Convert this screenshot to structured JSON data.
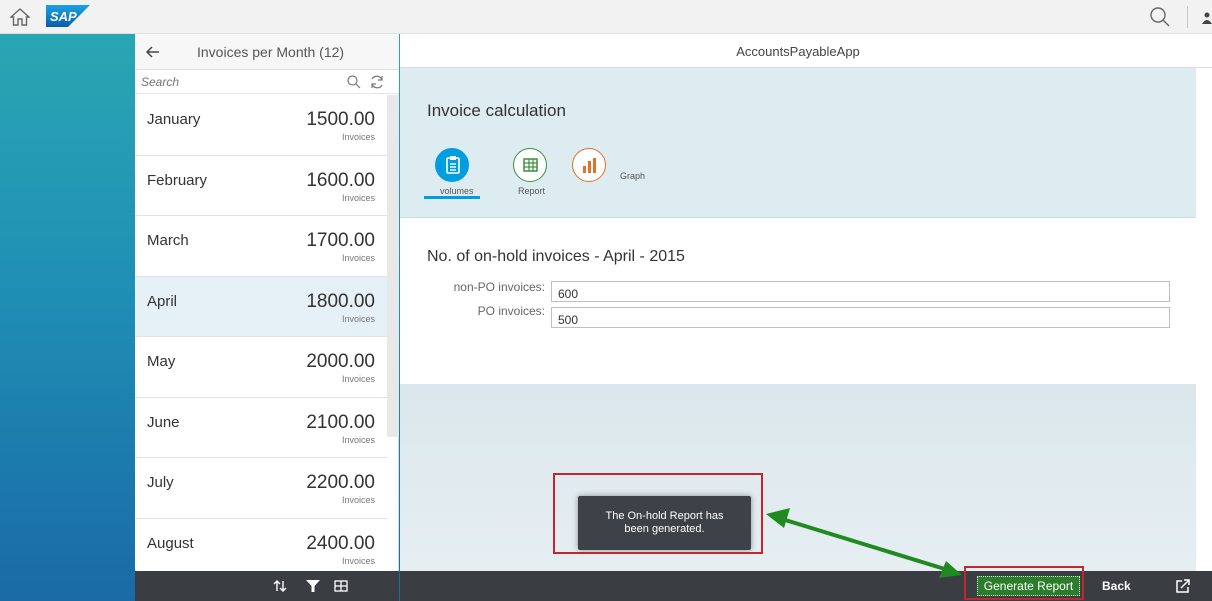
{
  "shell": {
    "logo_text": "SAP",
    "home_icon": "home-icon",
    "search_icon": "search-icon",
    "user_icon": "user-icon"
  },
  "master": {
    "title": "Invoices per Month (12)",
    "search_placeholder": "Search",
    "items": [
      {
        "name": "January",
        "value": "1500.00",
        "unit": "Invoices",
        "selected": false
      },
      {
        "name": "February",
        "value": "1600.00",
        "unit": "Invoices",
        "selected": false
      },
      {
        "name": "March",
        "value": "1700.00",
        "unit": "Invoices",
        "selected": false
      },
      {
        "name": "April",
        "value": "1800.00",
        "unit": "Invoices",
        "selected": true
      },
      {
        "name": "May",
        "value": "2000.00",
        "unit": "Invoices",
        "selected": false
      },
      {
        "name": "June",
        "value": "2100.00",
        "unit": "Invoices",
        "selected": false
      },
      {
        "name": "July",
        "value": "2200.00",
        "unit": "Invoices",
        "selected": false
      },
      {
        "name": "August",
        "value": "2400.00",
        "unit": "Invoices",
        "selected": false
      }
    ],
    "footer_icons": [
      "sort-icon",
      "filter-icon",
      "group-icon"
    ]
  },
  "detail": {
    "app_title": "AccountsPayableApp",
    "hero_title": "Invoice calculation",
    "tabs": [
      {
        "label": "volumes",
        "icon": "clipboard-icon",
        "color": "#009de0",
        "active": true
      },
      {
        "label": "Report",
        "icon": "table-icon",
        "color": "#3c8f3c",
        "active": false
      },
      {
        "label": "Graph",
        "icon": "bar-chart-icon",
        "color": "#e0702a",
        "active": false
      }
    ],
    "form_title": "No. of on-hold invoices - April - 2015",
    "fields": [
      {
        "label": "non-PO invoices:",
        "value": "600"
      },
      {
        "label": "PO invoices:",
        "value": "500"
      }
    ],
    "footer": {
      "generate_label": "Generate Report",
      "back_label": "Back",
      "share_icon": "share-icon"
    }
  },
  "toast": {
    "line1": "The On-hold Report has",
    "line2": "been generated."
  },
  "colors": {
    "accent": "#009de0",
    "footer": "#3a3d41",
    "generate": "#2b7d2b",
    "annotation_red": "#c0282d",
    "annotation_green": "#1f8a1f"
  }
}
